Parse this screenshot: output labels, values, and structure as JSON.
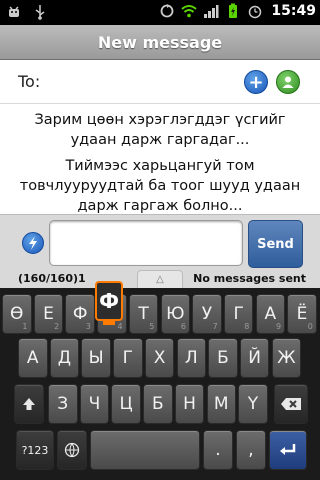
{
  "status_bar": {
    "time": "15:49",
    "left_icons": [
      "android-debug-icon",
      "usb-icon"
    ],
    "right_icons": [
      "sync-icon",
      "wifi-icon",
      "signal-icon",
      "battery-icon",
      "alarm-icon"
    ]
  },
  "header": {
    "title": "New message"
  },
  "recipient": {
    "label": "To:",
    "value": ""
  },
  "message": {
    "paragraph1": "Зарим цөөн хэрэглэгддэг үсгийг удаан дарж гаргадаг...",
    "paragraph2": "Тиймээс харьцангуй том товчлууруудтай ба тоог шууд удаан дарж гаргаж болно..."
  },
  "compose": {
    "value": "",
    "send_label": "Send"
  },
  "counter": {
    "chars": "(160/160)1",
    "status": "No messages sent"
  },
  "keyboard": {
    "row1": [
      "Ө",
      "Е",
      "Ф",
      "Р",
      "Т",
      "Ю",
      "У",
      "Г",
      "А",
      "Ё"
    ],
    "row1_hints": [
      "1",
      "2",
      "3",
      "4",
      "5",
      "6",
      "7",
      "8",
      "9",
      "0"
    ],
    "row2": [
      "А",
      "Д",
      "Ы",
      "Г",
      "Х",
      "Л",
      "Б",
      "Й",
      "Ж"
    ],
    "row2_hints": [
      "",
      "",
      "",
      "",
      "",
      "",
      "",
      "",
      ""
    ],
    "row3": [
      "З",
      "Ч",
      "Ц",
      "Б",
      "Н",
      "М",
      "Ү"
    ],
    "row3_hints": [
      "",
      "",
      "",
      "",
      "",
      "",
      ""
    ],
    "sym_label": "?123",
    "period": ".",
    "comma": ",",
    "popup_key": "Ф"
  },
  "accent_colors": {
    "send": "#2f5e9c",
    "popup_border": "#ff7a00",
    "add_icon": "#1a56b8",
    "contact_icon": "#2e8d1f"
  }
}
